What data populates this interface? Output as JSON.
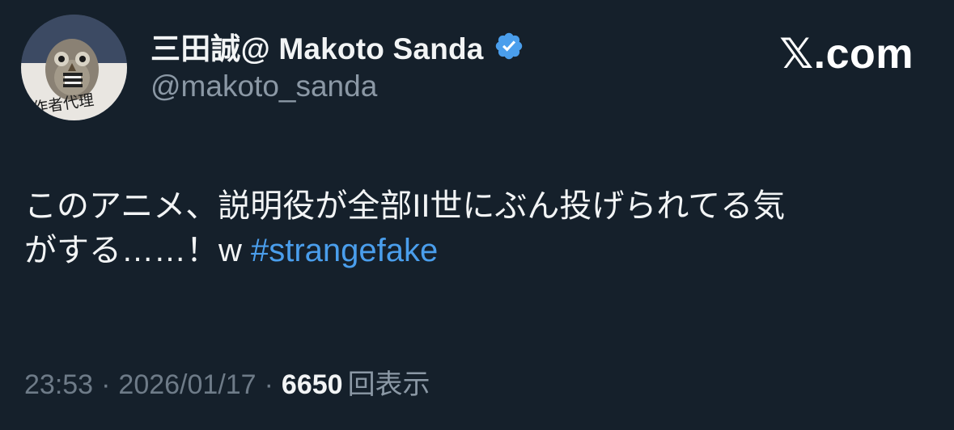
{
  "author": {
    "display_name": "三田誠@ Makoto Sanda",
    "handle": "@makoto_sanda",
    "avatar_caption": "作者代理",
    "verified_icon": "verified-badge-icon"
  },
  "brand": {
    "label": "𝕏.com"
  },
  "tweet": {
    "line1": "このアニメ、説明役が全部II世にぶん投げられてる気",
    "line2_text": "がする……！w ",
    "hashtag": "#strangefake"
  },
  "meta": {
    "time": "23:53",
    "separator": "·",
    "date": "2026/01/17",
    "views_count": "6650",
    "views_label": "回表示"
  },
  "colors": {
    "background": "#15202b",
    "hashtag": "#4a9eec",
    "verified": "#4a9eec",
    "secondary_text": "#8b98a5"
  }
}
